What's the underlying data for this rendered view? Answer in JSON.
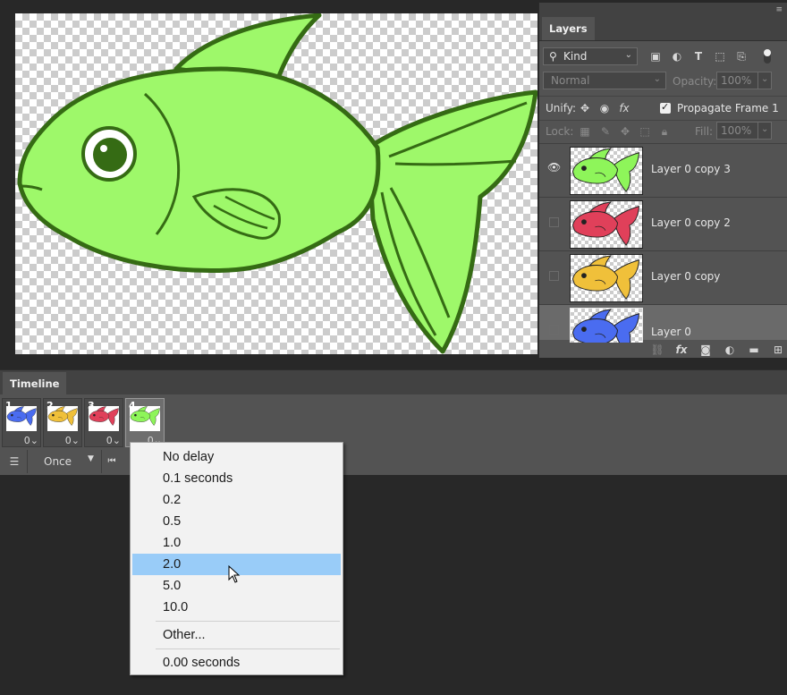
{
  "layers_panel": {
    "tab_label": "Layers",
    "filter_kind": "Kind",
    "blend_mode": "Normal",
    "opacity_label": "Opacity:",
    "opacity_value": "100%",
    "unify_label": "Unify:",
    "propagate_label": "Propagate Frame 1",
    "propagate_checked": true,
    "lock_label": "Lock:",
    "fill_label": "Fill:",
    "fill_value": "100%",
    "layers": [
      {
        "name": "Layer 0 copy 3",
        "visible": true,
        "fish_color": "#8ef55a"
      },
      {
        "name": "Layer 0 copy 2",
        "visible": false,
        "fish_color": "#e0405a"
      },
      {
        "name": "Layer 0 copy",
        "visible": false,
        "fish_color": "#f0c03a"
      },
      {
        "name": "Layer 0",
        "visible": false,
        "fish_color": "#4a6cf0",
        "active": true
      }
    ]
  },
  "timeline": {
    "tab_label": "Timeline",
    "frames": [
      {
        "number": "1",
        "delay": "0",
        "fish_color": "#4a6cf0"
      },
      {
        "number": "2",
        "delay": "0",
        "fish_color": "#f0c03a"
      },
      {
        "number": "3",
        "delay": "0",
        "fish_color": "#e0405a"
      },
      {
        "number": "4",
        "delay": "0",
        "fish_color": "#8ef55a",
        "selected": true
      }
    ],
    "loop_option": "Once"
  },
  "delay_menu": {
    "items": [
      "No delay",
      "0.1 seconds",
      "0.2",
      "0.5",
      "1.0",
      "2.0",
      "5.0",
      "10.0"
    ],
    "highlighted": "2.0",
    "other_label": "Other...",
    "current_label": "0.00 seconds"
  },
  "colors": {
    "fish_body": "#9ef86a",
    "fish_outline": "#356b14",
    "menu_highlight": "#99ccf8",
    "panel_bg": "#535353"
  }
}
